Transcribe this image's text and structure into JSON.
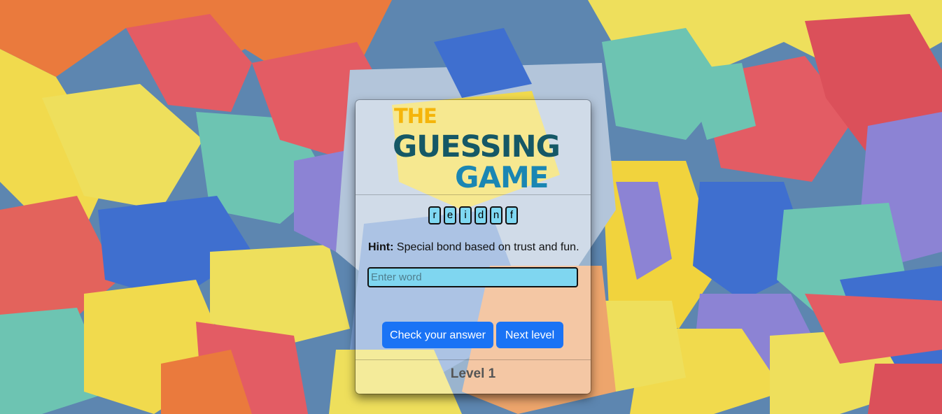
{
  "game": {
    "logo": {
      "line1": "THE",
      "line2": "GUESSING",
      "line3": "GAME"
    },
    "scrambled_letters": [
      "r",
      "e",
      "i",
      "d",
      "n",
      "f"
    ],
    "hint": {
      "label": "Hint:",
      "text": "Special bond based on trust and fun."
    },
    "answer_input": {
      "placeholder": "Enter word",
      "value": ""
    },
    "buttons": {
      "check": "Check your answer",
      "next": "Next level"
    },
    "level_text": "Level 1"
  },
  "colors": {
    "logo_the": "#f5b50a",
    "logo_guessing": "#155866",
    "logo_game": "#1a86b3",
    "tile_fill": "#7fd8f2",
    "button_primary": "#1a73f5",
    "card_overlay": "rgba(255,255,255,0.38)"
  },
  "background": {
    "description_icon": "foam-letters-background"
  }
}
